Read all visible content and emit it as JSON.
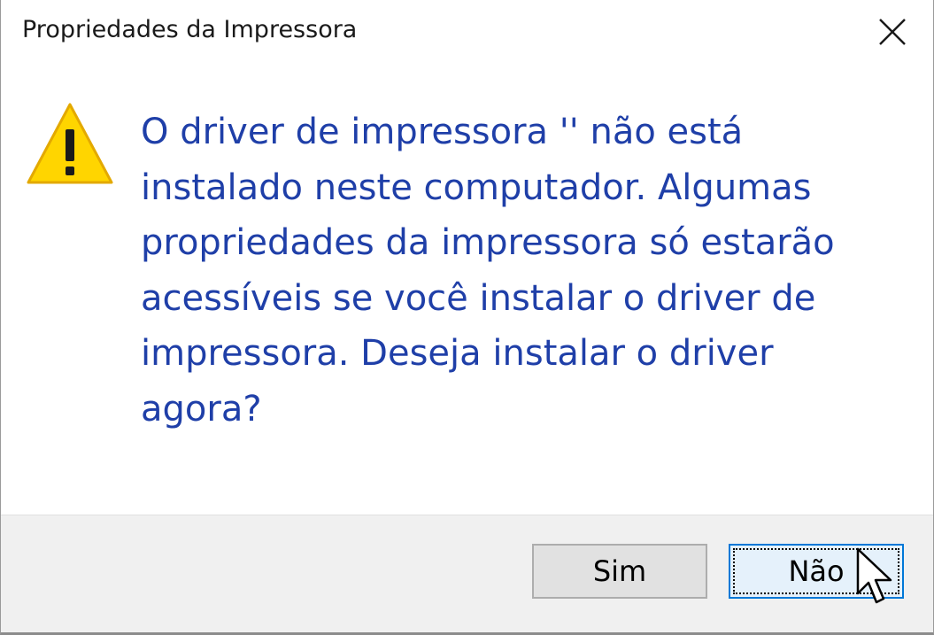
{
  "window": {
    "title": "Propriedades da Impressora"
  },
  "dialog": {
    "icon": "warning-icon",
    "message": "O driver de impressora '' não está instalado neste computador. Algumas propriedades da impressora só estarão acessíveis se você instalar o driver de impressora. Deseja instalar o driver agora?"
  },
  "buttons": {
    "yes_label": "Sim",
    "no_label": "Não"
  },
  "colors": {
    "message_text": "#1f3fa8",
    "warning_fill": "#ffd500",
    "focus_border": "#0078d7"
  }
}
